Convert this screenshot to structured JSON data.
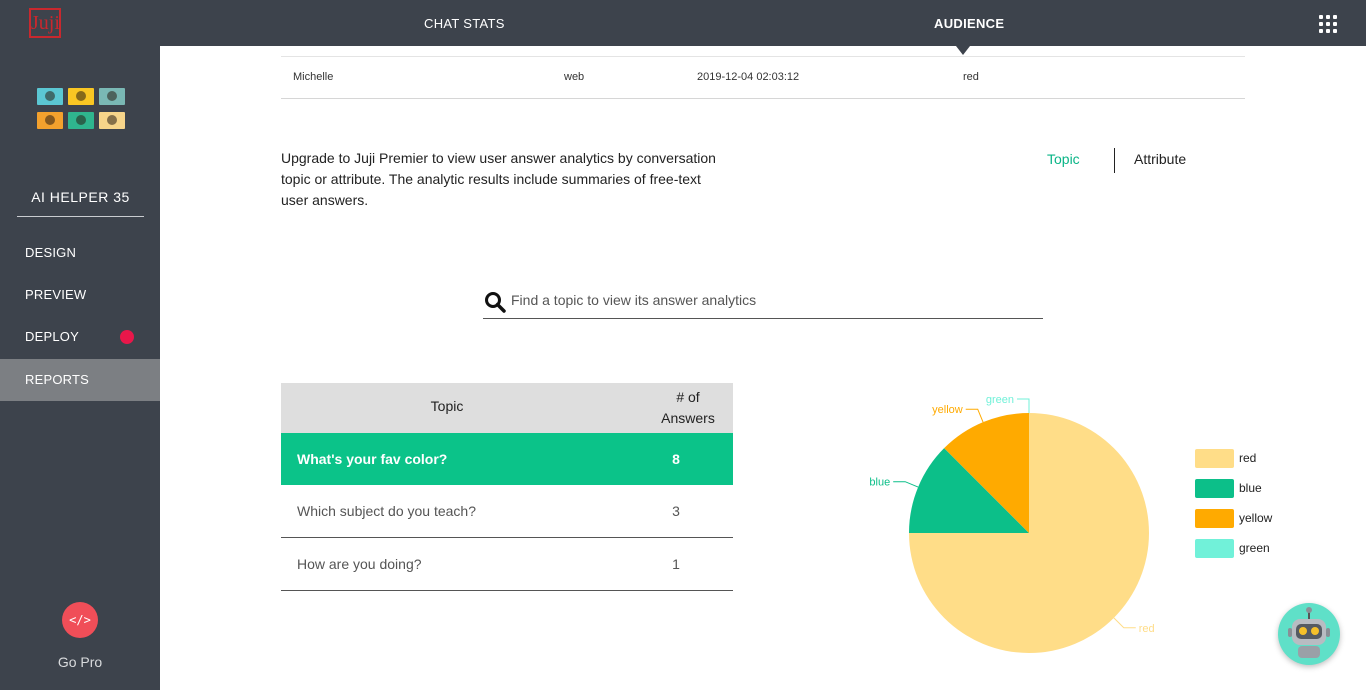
{
  "header": {
    "logo_text": "Juji",
    "nav": [
      {
        "label": "CHAT STATS",
        "active": false
      },
      {
        "label": "AUDIENCE",
        "active": true
      }
    ],
    "apps_icon": "grid-icon"
  },
  "sidebar": {
    "app_name": "AI HELPER 35",
    "items": [
      {
        "label": "DESIGN",
        "active": false
      },
      {
        "label": "PREVIEW",
        "active": false
      },
      {
        "label": "DEPLOY",
        "active": false,
        "alert": true
      },
      {
        "label": "REPORTS",
        "active": true
      }
    ],
    "go_pro": {
      "icon_text": "</>",
      "label": "Go Pro"
    }
  },
  "user_row": {
    "name": "Michelle",
    "channel": "web",
    "timestamp": "2019-12-04 02:03:12",
    "answer": "red"
  },
  "upgrade_text": "Upgrade to Juji Premier to view user answer analytics by conversation topic or attribute. The analytic results include summaries of free-text user answers.",
  "toggle": {
    "topic": "Topic",
    "attribute": "Attribute",
    "selected": "Topic"
  },
  "search": {
    "placeholder": "Find a topic to view its answer analytics",
    "value": ""
  },
  "topics_table": {
    "headers": {
      "topic": "Topic",
      "answers_line1": "# of",
      "answers_line2": "Answers"
    },
    "rows": [
      {
        "topic": "What's your fav color?",
        "answers": "8",
        "selected": true
      },
      {
        "topic": "Which subject do you teach?",
        "answers": "3",
        "selected": false
      },
      {
        "topic": "How are you doing?",
        "answers": "1",
        "selected": false
      }
    ]
  },
  "chart_data": {
    "type": "pie",
    "slices": [
      {
        "label": "red",
        "value": 6,
        "color": "#ffdd88"
      },
      {
        "label": "blue",
        "value": 1,
        "color": "#0cbf89"
      },
      {
        "label": "yellow",
        "value": 1,
        "color": "#ffaa00"
      },
      {
        "label": "green",
        "value": 0,
        "color": "#71f1d9"
      }
    ],
    "legend": [
      "red",
      "blue",
      "yellow",
      "green"
    ],
    "legend_position": "right"
  },
  "colors": {
    "accent": "#0bc389",
    "sidebar": "#3d434c",
    "alert": "#e8174a"
  }
}
